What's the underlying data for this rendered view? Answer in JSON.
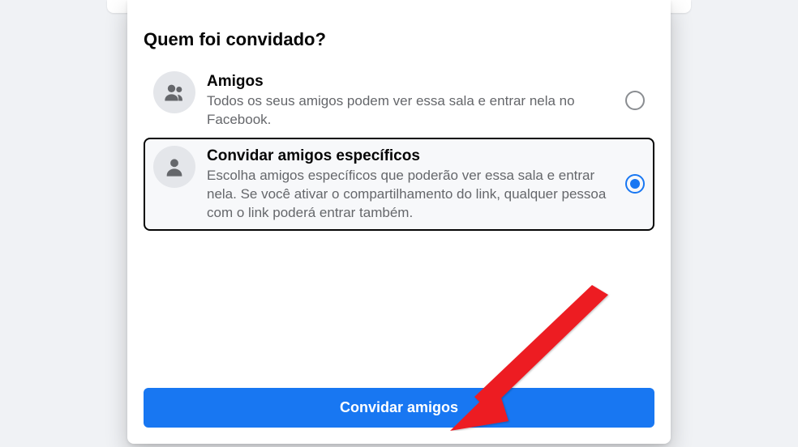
{
  "section_title": "Quem foi convidado?",
  "options": [
    {
      "title": "Amigos",
      "description": "Todos os seus amigos podem ver essa sala e entrar nela no Facebook."
    },
    {
      "title": "Convidar amigos específicos",
      "description": "Escolha amigos específicos que poderão ver essa sala e entrar nela. Se você ativar o compartilhamento do link, qualquer pessoa com o link poderá entrar também."
    }
  ],
  "primary_button": "Convidar amigos"
}
